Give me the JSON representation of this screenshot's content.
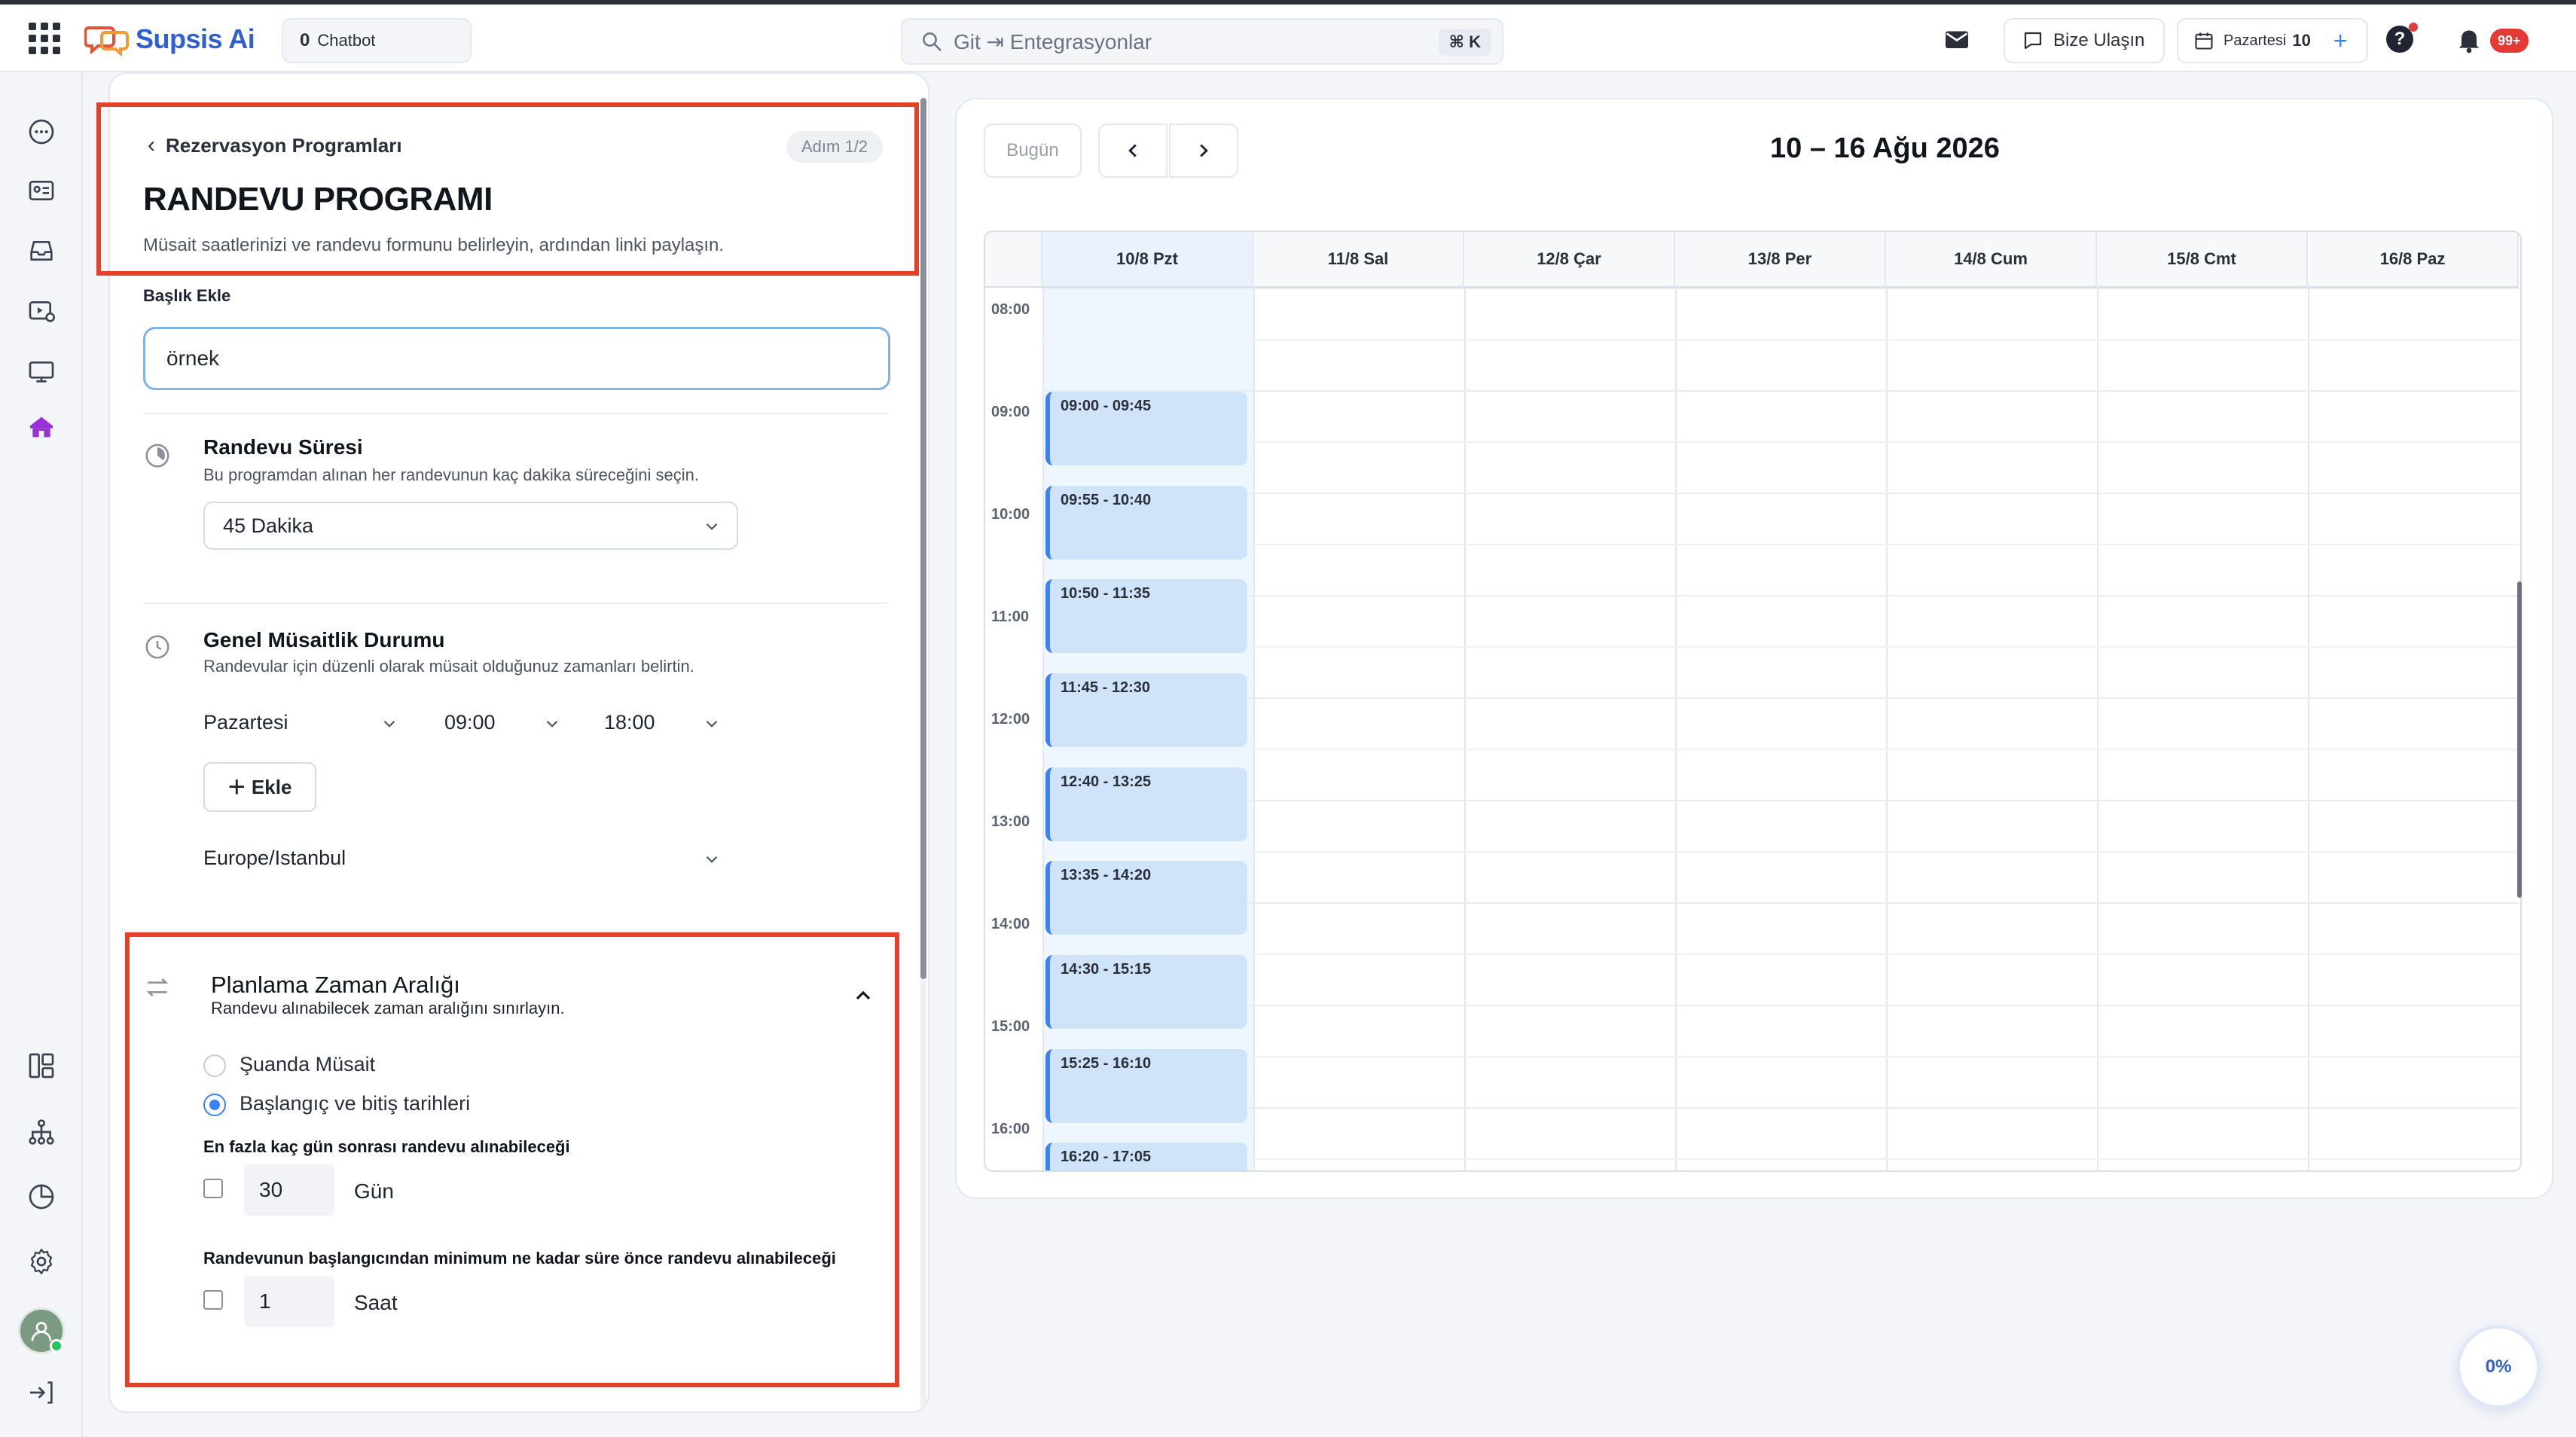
{
  "brand": {
    "name": "Supsis Ai",
    "accent": "#2f5fd0"
  },
  "topbar": {
    "chatbot_count": "0",
    "chatbot_label": "Chatbot",
    "search_text": "Git ⇥ Entegrasyonlar",
    "search_shortcut": "⌘ K",
    "contact_label": "Bize Ulaşın",
    "day_label": "Pazartesi",
    "day_number": "10",
    "add_symbol": "+",
    "help_symbol": "?",
    "notification_badge": "99+"
  },
  "sidebar": {
    "icons": [
      "chat-icon",
      "contacts-icon",
      "inbox-icon",
      "media-settings-icon",
      "monitor-icon",
      "home-icon",
      "layout-icon",
      "hierarchy-icon",
      "analytics-icon",
      "settings-icon",
      "avatar",
      "logout-icon"
    ],
    "active_color": "#9b30d9"
  },
  "form": {
    "back_label": "Rezervasyon Programları",
    "step_label": "Adım 1/2",
    "title": "RANDEVU PROGRAMI",
    "subtitle": "Müsait saatlerinizi ve randevu formunu belirleyin, ardından linki paylaşın.",
    "title_field_label": "Başlık Ekle",
    "title_field_value": "örnek",
    "duration": {
      "title": "Randevu Süresi",
      "description": "Bu programdan alınan her randevunun kaç dakika süreceğini seçin.",
      "value": "45 Dakika"
    },
    "availability": {
      "title": "Genel Müsaitlik Durumu",
      "description": "Randevular için düzenli olarak müsait olduğunuz zamanları belirtin.",
      "day": "Pazartesi",
      "start": "09:00",
      "end": "18:00",
      "add_label": "Ekle",
      "timezone": "Europe/Istanbul"
    },
    "range": {
      "title": "Planlama Zaman Aralığı",
      "description": "Randevu alınabilecek zaman aralığını sınırlayın.",
      "option_now": "Şuanda Müsait",
      "option_dates": "Başlangıç ve bitiş tarihleri",
      "selected": "option_dates",
      "max_days_label": "En fazla kaç gün sonrası randevu alınabileceği",
      "max_days_value": "30",
      "max_days_unit": "Gün",
      "min_notice_label": "Randevunun başlangıcından minimum ne kadar süre önce randevu alınabileceği",
      "min_notice_value": "1",
      "min_notice_unit": "Saat"
    }
  },
  "calendar": {
    "today_label": "Bugün",
    "title": "10 – 16 Ağu 2026",
    "days": [
      "10/8 Pzt",
      "11/8 Sal",
      "12/8 Çar",
      "13/8 Per",
      "14/8 Cum",
      "15/8 Cmt",
      "16/8 Paz"
    ],
    "today_index": 0,
    "hours": [
      "08:00",
      "09:00",
      "10:00",
      "11:00",
      "12:00",
      "13:00",
      "14:00",
      "15:00",
      "16:00"
    ],
    "events": [
      "09:00 - 09:45",
      "09:55 - 10:40",
      "10:50 - 11:35",
      "11:45 - 12:30",
      "12:40 - 13:25",
      "13:35 - 14:20",
      "14:30 - 15:15",
      "15:25 - 16:10",
      "16:20 - 17:05"
    ],
    "event_color": "#cfe3f9"
  },
  "progress": {
    "label": "0%"
  }
}
